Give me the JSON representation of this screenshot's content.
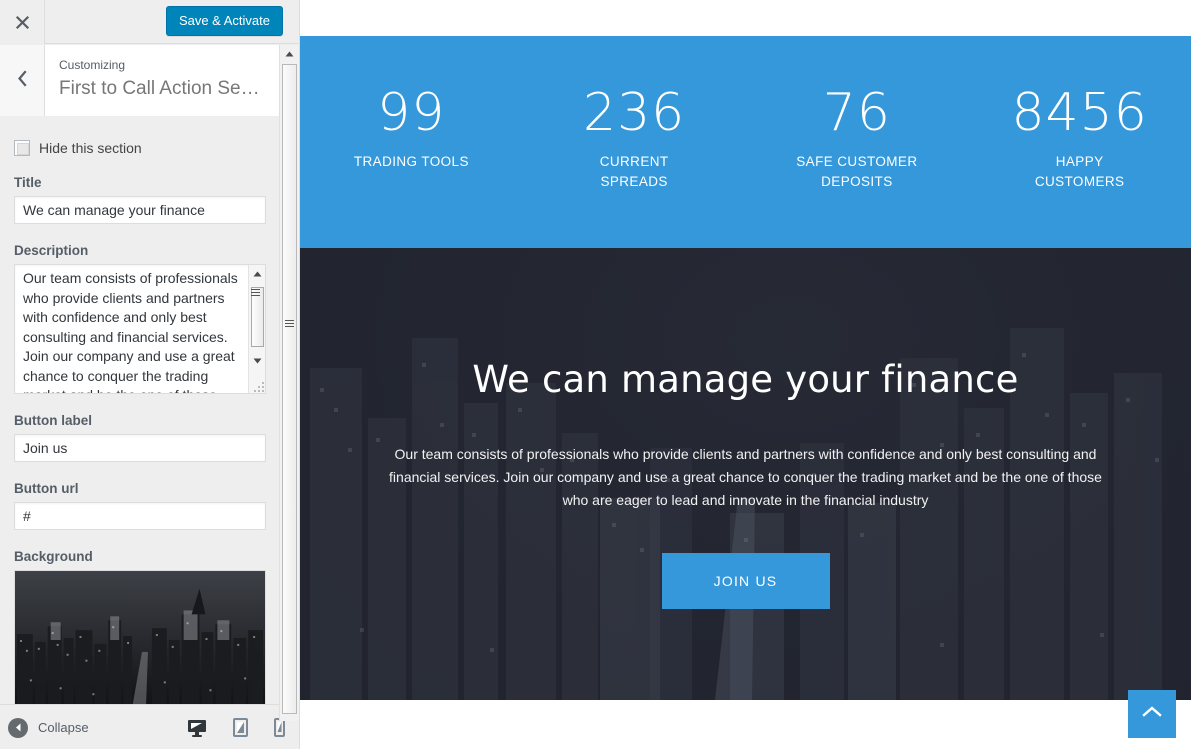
{
  "customizer": {
    "close_icon": "close-icon",
    "save_label": "Save & Activate",
    "back_icon": "chevron-left-icon",
    "kicker": "Customizing",
    "section_title": "First to Call Action Se…",
    "hide_section_label": "Hide this section",
    "controls": {
      "title_label": "Title",
      "title_value": "We can manage your finance",
      "description_label": "Description",
      "description_value": "Our team consists of professionals who provide clients and partners with confidence and only best consulting and financial services. Join our company and use a great chance to conquer the trading market and be the one of those who are eager to lead and innovate in the financial industry",
      "button_label_label": "Button label",
      "button_label_value": "Join us",
      "button_url_label": "Button url",
      "button_url_value": "#",
      "background_label": "Background",
      "background_thumb_name": "city-skyline-night-grayscale"
    },
    "footer": {
      "collapse_label": "Collapse",
      "devices": [
        {
          "name": "desktop-preview",
          "icon": "desktop-icon",
          "active": true
        },
        {
          "name": "tablet-preview",
          "icon": "tablet-icon",
          "active": false
        },
        {
          "name": "mobile-preview",
          "icon": "mobile-icon",
          "active": false
        }
      ]
    }
  },
  "preview": {
    "stats": [
      {
        "number": "99",
        "label": "TRADING TOOLS"
      },
      {
        "number": "236",
        "label": "CURRENT SPREADS"
      },
      {
        "number": "76",
        "label": "SAFE CUSTOMER DEPOSITS"
      },
      {
        "number": "8456",
        "label": "HAPPY CUSTOMERS"
      }
    ],
    "hero": {
      "title": "We can manage your finance",
      "description": "Our team consists of professionals who provide clients and partners with confidence and only best consulting and financial services. Join our company and use a great chance to conquer the trading market and be the one of those who are eager to lead and innovate in the financial industry",
      "button_label": "JOIN US"
    },
    "scroll_top_icon": "chevron-up-icon"
  },
  "colors": {
    "accent_blue": "#3498db",
    "wp_blue": "#0085ba",
    "hero_dark": "#222530",
    "sidebar_bg": "#eeeeee"
  }
}
